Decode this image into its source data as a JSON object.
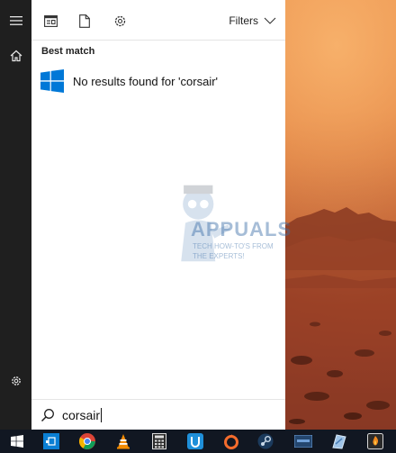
{
  "search_panel": {
    "filters_label": "Filters",
    "best_match_heading": "Best match",
    "result_text": "No results found for 'corsair'",
    "search_query": "corsair"
  },
  "watermark": {
    "title": "APPUALS",
    "subtitle": "TECH HOW-TO'S FROM THE EXPERTS!"
  },
  "icons": {
    "rail": [
      "hamburger-menu-icon",
      "home-icon",
      "settings-icon"
    ],
    "panel_top": [
      "apps-view-icon",
      "documents-icon",
      "settings-icon",
      "chevron-down-icon"
    ],
    "taskbar": [
      "windows-start-icon",
      "store-icon",
      "chrome-icon",
      "vlc-icon",
      "calculator-icon",
      "uplay-icon",
      "origin-icon",
      "steam-icon",
      "app-icon",
      "paint-icon",
      "orange-app-icon"
    ]
  },
  "colors": {
    "rail_bg": "#1f1f1f",
    "taskbar_bg": "#111722",
    "windows_blue": "#0078d7"
  }
}
